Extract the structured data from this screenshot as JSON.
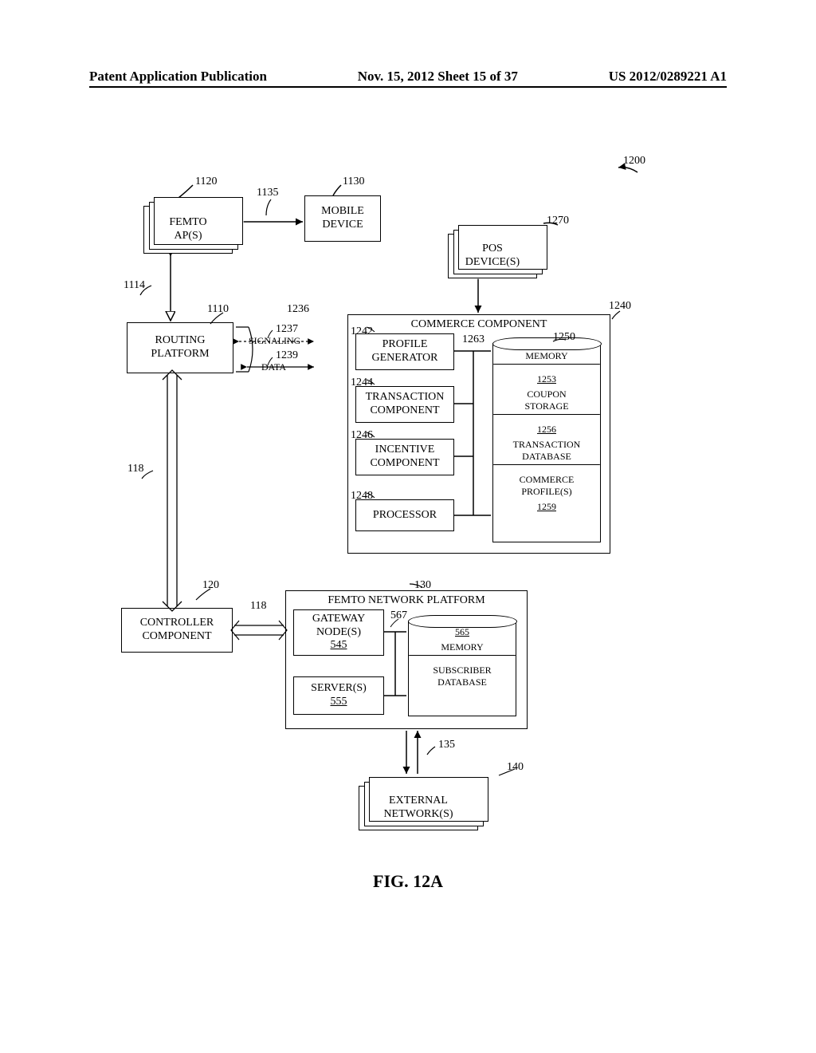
{
  "header": {
    "left": "Patent Application Publication",
    "center": "Nov. 15, 2012  Sheet 15 of 37",
    "right": "US 2012/0289221 A1"
  },
  "fig_caption": "FIG. 12A",
  "refs": {
    "r1200": "1200",
    "r1120": "1120",
    "r1135": "1135",
    "r1130": "1130",
    "r1114": "1114",
    "r1110": "1110",
    "r1236": "1236",
    "r1237": "1237",
    "r1239": "1239",
    "r1242": "1242",
    "r1244": "1244",
    "r1246": "1246",
    "r1248": "1248",
    "r1263": "1263",
    "r1270": "1270",
    "r1250": "1250",
    "r1240": "1240",
    "r118a": "118",
    "r120": "120",
    "r118b": "118",
    "r130": "130",
    "r567": "567",
    "r135": "135",
    "r140": "140"
  },
  "boxes": {
    "femto_ap": "FEMTO\nAP(S)",
    "mobile_device": "MOBILE\nDEVICE",
    "pos_devices": "POS\nDEVICE(S)",
    "routing_platform": "ROUTING\nPLATFORM",
    "signaling": "SIGNALING",
    "data": "DATA",
    "commerce_component": "COMMERCE COMPONENT",
    "profile_generator": "PROFILE\nGENERATOR",
    "transaction_component": "TRANSACTION\nCOMPONENT",
    "incentive_component": "INCENTIVE\nCOMPONENT",
    "processor": "PROCESSOR",
    "memory_label": "MEMORY",
    "coupon_storage": "COUPON\nSTORAGE",
    "transaction_db": "TRANSACTION\nDATABASE",
    "commerce_profiles": "COMMERCE\nPROFILE(S)",
    "n1253": "1253",
    "n1256": "1256",
    "n1259": "1259",
    "controller_component": "CONTROLLER\nCOMPONENT",
    "femto_network_platform": "FEMTO NETWORK PLATFORM",
    "gateway_nodes": "GATEWAY\nNODE(S)",
    "gateway_num": "545",
    "servers": "SERVER(S)",
    "servers_num": "555",
    "memory2": "MEMORY",
    "memory2_num": "565",
    "subscriber_db": "SUBSCRIBER\nDATABASE",
    "external_networks": "EXTERNAL\nNETWORK(S)"
  }
}
